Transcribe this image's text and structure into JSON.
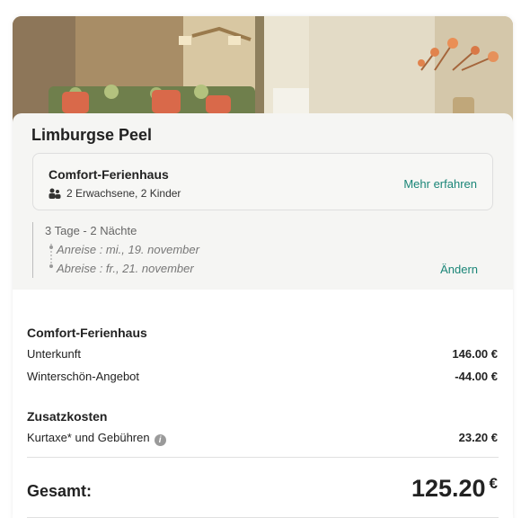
{
  "location": {
    "title": "Limburgse Peel"
  },
  "house": {
    "name": "Comfort-Ferienhaus",
    "guests": "2 Erwachsene, 2 Kinder",
    "more_link": "Mehr erfahren"
  },
  "stay": {
    "duration": "3 Tage - 2 Nächte",
    "arrival": "Anreise : mi., 19. november",
    "departure": "Abreise : fr., 21. november",
    "change_link": "Ändern"
  },
  "price": {
    "section_title": "Comfort-Ferienhaus",
    "lines": [
      {
        "label": "Unterkunft",
        "value": "146.00 €"
      },
      {
        "label": "Winterschön-Angebot",
        "value": "-44.00 €"
      }
    ],
    "extra_title": "Zusatzkosten",
    "extra_lines": [
      {
        "label": "Kurtaxe* und Gebühren",
        "value": "23.20 €"
      }
    ],
    "total_label": "Gesamt:",
    "total_value": "125.20",
    "currency": "€"
  },
  "colors": {
    "accent": "#1a8577",
    "panel": "#f5f5f3"
  },
  "icons": {
    "guests": "people-icon",
    "info": "info-icon"
  }
}
